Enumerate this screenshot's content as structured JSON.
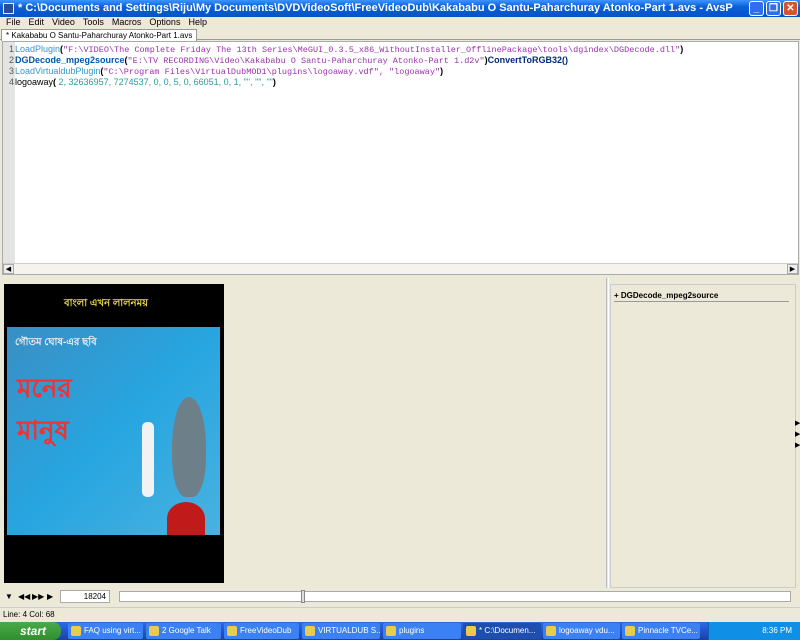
{
  "window": {
    "title": "* C:\\Documents and Settings\\Riju\\My Documents\\DVDVideoSoft\\FreeVideoDub\\Kakababu O Santu-Paharchuray Atonko-Part 1.avs - AvsP"
  },
  "menu": [
    "File",
    "Edit",
    "Video",
    "Tools",
    "Macros",
    "Options",
    "Help"
  ],
  "tab": "* Kakababu O Santu-Paharchuray Atonko-Part 1.avs",
  "script": [
    {
      "n": "1",
      "fn": "LoadPlugin",
      "arg": "\"F:\\VIDEO\\The Complete Friday The 13th Series\\MeGUI_0.3.5_x86_WithoutInstaller_OfflinePackage\\tools\\dgindex\\DGDecode.dll\""
    },
    {
      "n": "2",
      "fn": "DGDecode_mpeg2source",
      "arg": "\"E:\\TV RECORDING\\Video\\Kakababu O Santu-Paharchuray Atonko-Part 1.d2v\"",
      "tail": "ConvertToRGB32()"
    },
    {
      "n": "3",
      "fn": "LoadVirtualdubPlugin",
      "arg": "\"C:\\Program Files\\VirtualDubMOD1\\plugins\\logoaway.vdf\", \"logoaway\""
    },
    {
      "n": "4",
      "fn": "logoaway",
      "arg": " 2, 32636957, 7274537, 0, 0, 5, 0, 66051, 0, 1, \"\", \"\", \"\""
    }
  ],
  "video": {
    "banner": "বাংলা এখন লালনময়",
    "credit": "গৌতম ঘোষ-এর ছবি",
    "title": "মনের মানুষ"
  },
  "filters": {
    "item": "+ DGDecode_mpeg2source"
  },
  "controls": {
    "frame": "18204",
    "position": 0.27
  },
  "status": "Line: 4  Col: 68",
  "taskbar": {
    "start": "start",
    "tasks": [
      {
        "label": "FAQ using virt..."
      },
      {
        "label": "2 Google Talk"
      },
      {
        "label": "FreeVideoDub"
      },
      {
        "label": "VIRTUALDUB S..."
      },
      {
        "label": "plugins"
      },
      {
        "label": "* C:\\Documen...",
        "active": true
      },
      {
        "label": "logoaway vdu..."
      },
      {
        "label": "Pinnacle TVCe..."
      }
    ],
    "clock": "8:36 PM"
  }
}
